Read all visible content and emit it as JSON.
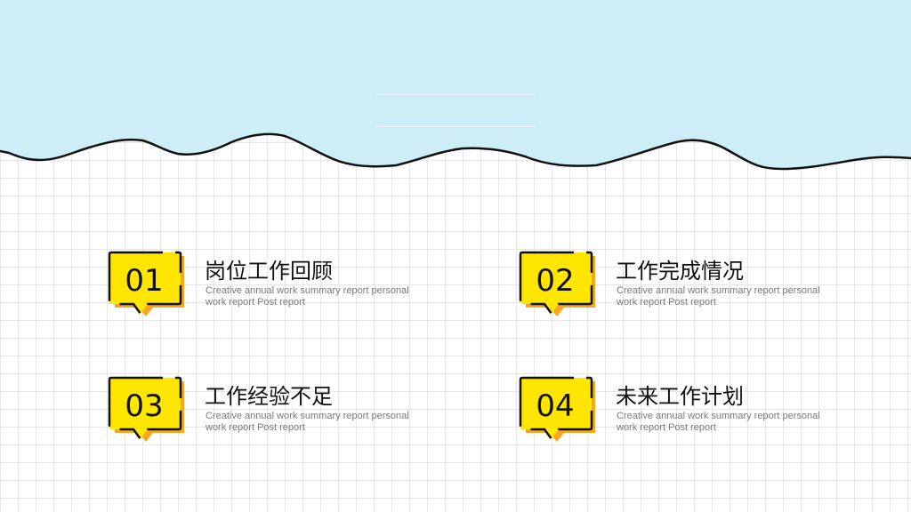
{
  "colors": {
    "sky": "#cdeef7",
    "badge_fill": "#ffe600",
    "badge_shadow": "#f6a623",
    "outline": "#111111"
  },
  "items": [
    {
      "number": "01",
      "title": "岗位工作回顾",
      "desc": "Creative annual work summary report personal work report Post report"
    },
    {
      "number": "02",
      "title": "工作完成情况",
      "desc": "Creative annual work summary report personal work report Post report"
    },
    {
      "number": "03",
      "title": "工作经验不足",
      "desc": "Creative annual work summary report personal work report Post report"
    },
    {
      "number": "04",
      "title": "未来工作计划",
      "desc": "Creative annual work summary report personal work report Post report"
    }
  ]
}
